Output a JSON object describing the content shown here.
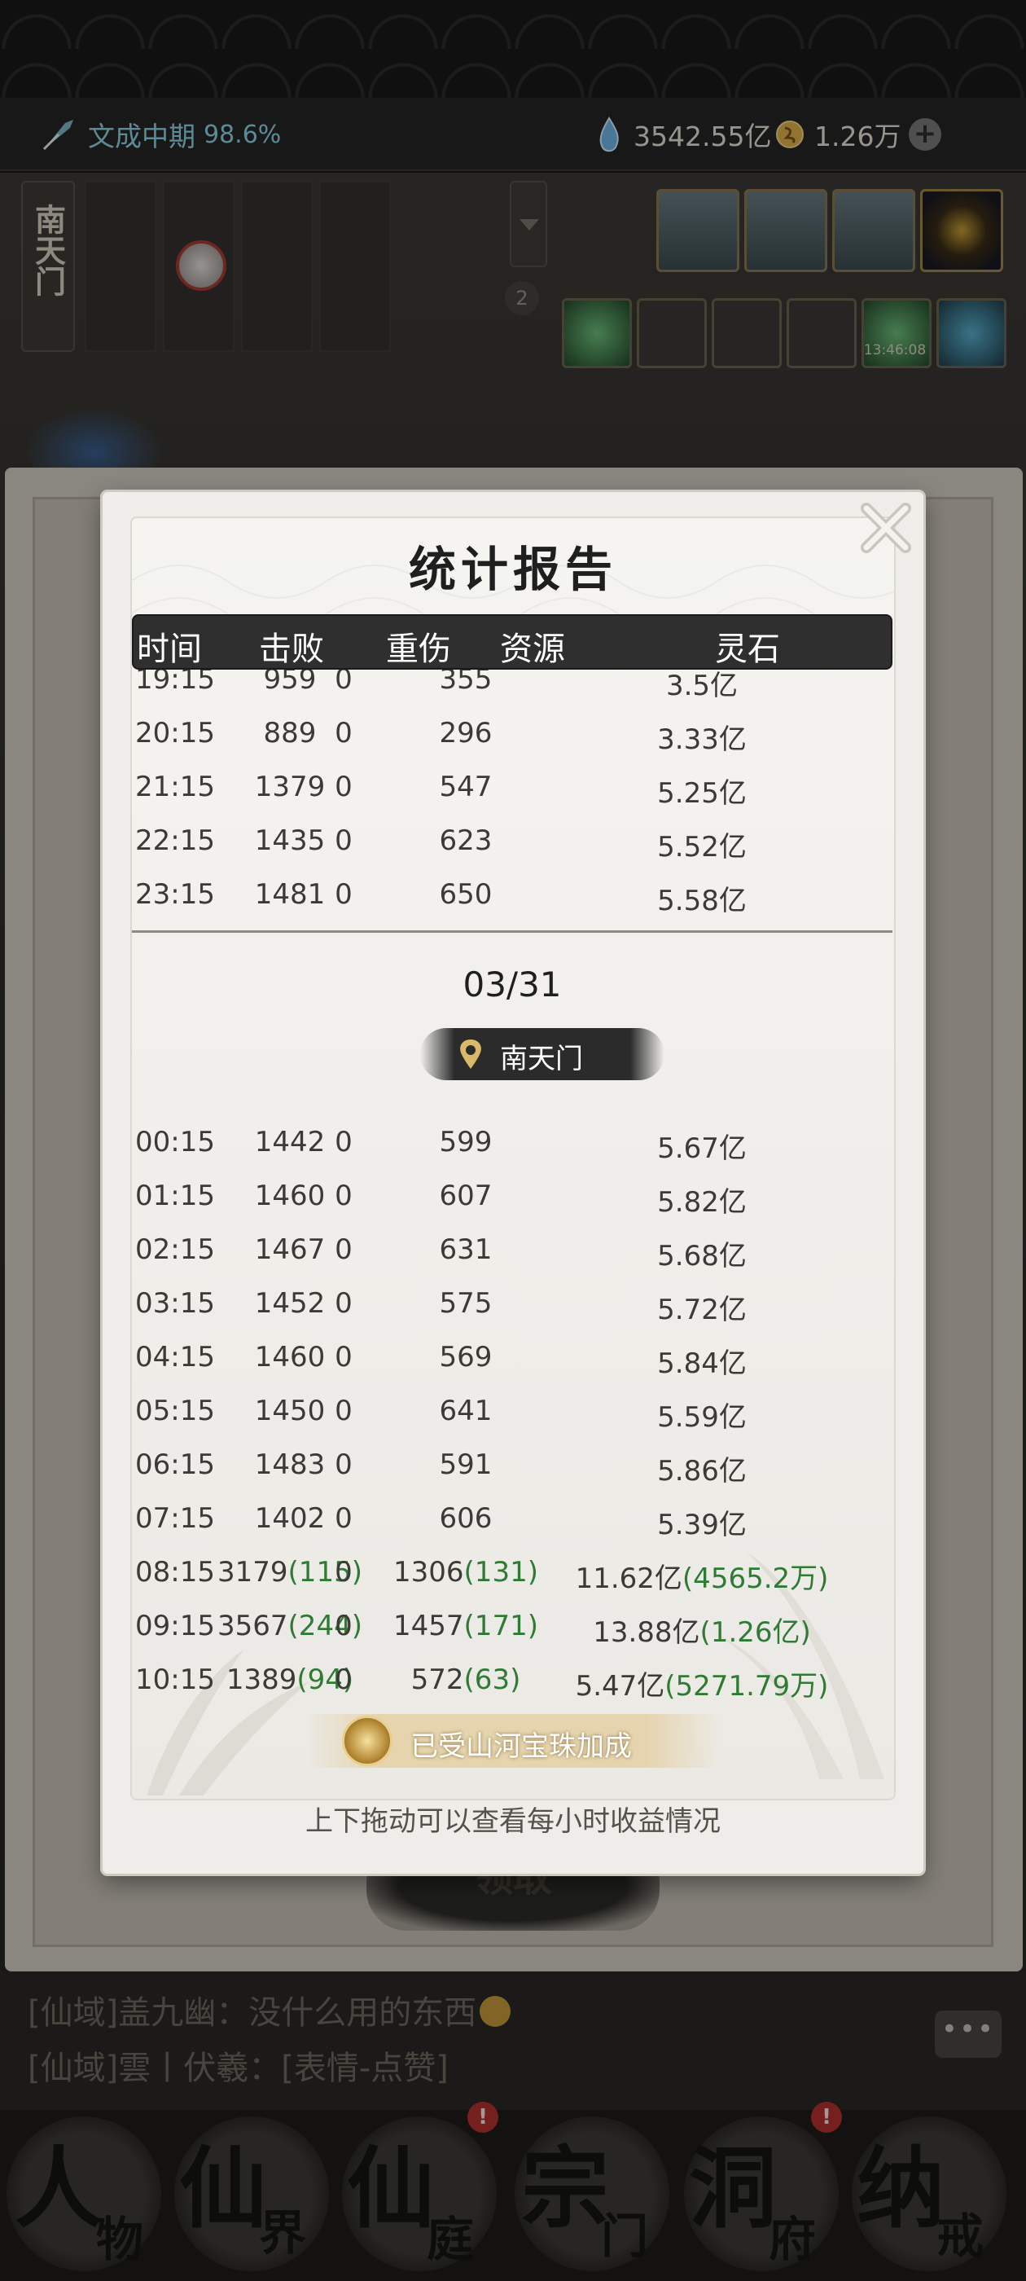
{
  "status_bar": {
    "realm": "文成中期",
    "realm_progress": "98.6%",
    "spirit_crystal": "3542.55亿",
    "gold": "1.26万",
    "plus_icon": "plus-icon"
  },
  "scene": {
    "location_tab": "南天门",
    "badge_count": "2",
    "timer": "13:46:08"
  },
  "claim_button_label": "领取",
  "modal": {
    "title": "统计报告",
    "headers": {
      "time": "时间",
      "kills": "击败",
      "injuries": "重伤",
      "resources": "资源",
      "stones": "灵石"
    },
    "rows_before": [
      {
        "time": "19:15",
        "kills": "959",
        "injuries": "0",
        "resources": "355",
        "stones": "3.5亿"
      },
      {
        "time": "20:15",
        "kills": "889",
        "injuries": "0",
        "resources": "296",
        "stones": "3.33亿"
      },
      {
        "time": "21:15",
        "kills": "1379",
        "injuries": "0",
        "resources": "547",
        "stones": "5.25亿"
      },
      {
        "time": "22:15",
        "kills": "1435",
        "injuries": "0",
        "resources": "623",
        "stones": "5.52亿"
      },
      {
        "time": "23:15",
        "kills": "1481",
        "injuries": "0",
        "resources": "650",
        "stones": "5.58亿"
      }
    ],
    "date": "03/31",
    "location": "南天门",
    "rows_after": [
      {
        "time": "00:15",
        "kills": "1442",
        "kills_bonus": "",
        "injuries": "0",
        "resources": "599",
        "resources_bonus": "",
        "stones": "5.67亿",
        "stones_bonus": ""
      },
      {
        "time": "01:15",
        "kills": "1460",
        "kills_bonus": "",
        "injuries": "0",
        "resources": "607",
        "resources_bonus": "",
        "stones": "5.82亿",
        "stones_bonus": ""
      },
      {
        "time": "02:15",
        "kills": "1467",
        "kills_bonus": "",
        "injuries": "0",
        "resources": "631",
        "resources_bonus": "",
        "stones": "5.68亿",
        "stones_bonus": ""
      },
      {
        "time": "03:15",
        "kills": "1452",
        "kills_bonus": "",
        "injuries": "0",
        "resources": "575",
        "resources_bonus": "",
        "stones": "5.72亿",
        "stones_bonus": ""
      },
      {
        "time": "04:15",
        "kills": "1460",
        "kills_bonus": "",
        "injuries": "0",
        "resources": "569",
        "resources_bonus": "",
        "stones": "5.84亿",
        "stones_bonus": ""
      },
      {
        "time": "05:15",
        "kills": "1450",
        "kills_bonus": "",
        "injuries": "0",
        "resources": "641",
        "resources_bonus": "",
        "stones": "5.59亿",
        "stones_bonus": ""
      },
      {
        "time": "06:15",
        "kills": "1483",
        "kills_bonus": "",
        "injuries": "0",
        "resources": "591",
        "resources_bonus": "",
        "stones": "5.86亿",
        "stones_bonus": ""
      },
      {
        "time": "07:15",
        "kills": "1402",
        "kills_bonus": "",
        "injuries": "0",
        "resources": "606",
        "resources_bonus": "",
        "stones": "5.39亿",
        "stones_bonus": ""
      },
      {
        "time": "08:15",
        "kills": "3179",
        "kills_bonus": "(115)",
        "injuries": "0",
        "resources": "1306",
        "resources_bonus": "(131)",
        "stones": "11.62亿",
        "stones_bonus": "(4565.2万)"
      },
      {
        "time": "09:15",
        "kills": "3567",
        "kills_bonus": "(244)",
        "injuries": "0",
        "resources": "1457",
        "resources_bonus": "(171)",
        "stones": "13.88亿",
        "stones_bonus": "(1.26亿)"
      },
      {
        "time": "10:15",
        "kills": "1389",
        "kills_bonus": "(94)",
        "injuries": "0",
        "resources": "572",
        "resources_bonus": "(63)",
        "stones": "5.47亿",
        "stones_bonus": "(5271.79万)"
      }
    ],
    "bonus_notice": "已受山河宝珠加成",
    "hint": "上下拖动可以查看每小时收益情况"
  },
  "chat": [
    {
      "text": "[仙域]盖九幽：没什么用的东西"
    },
    {
      "text": "[仙域]雲丨伏羲：[表情-点赞]"
    }
  ],
  "chat_button": "•••",
  "nav": [
    {
      "big": "人",
      "small": "物",
      "alert": false
    },
    {
      "big": "仙",
      "small": "界",
      "alert": false
    },
    {
      "big": "仙",
      "small": "庭",
      "alert": true
    },
    {
      "big": "宗",
      "small": "门",
      "alert": false
    },
    {
      "big": "洞",
      "small": "府",
      "alert": true
    },
    {
      "big": "纳",
      "small": "戒",
      "alert": false
    }
  ],
  "colors": {
    "bonus_green": "#2f7a34",
    "header_bg": "#2f2f2f",
    "realm_blue": "#8fd4e8"
  }
}
